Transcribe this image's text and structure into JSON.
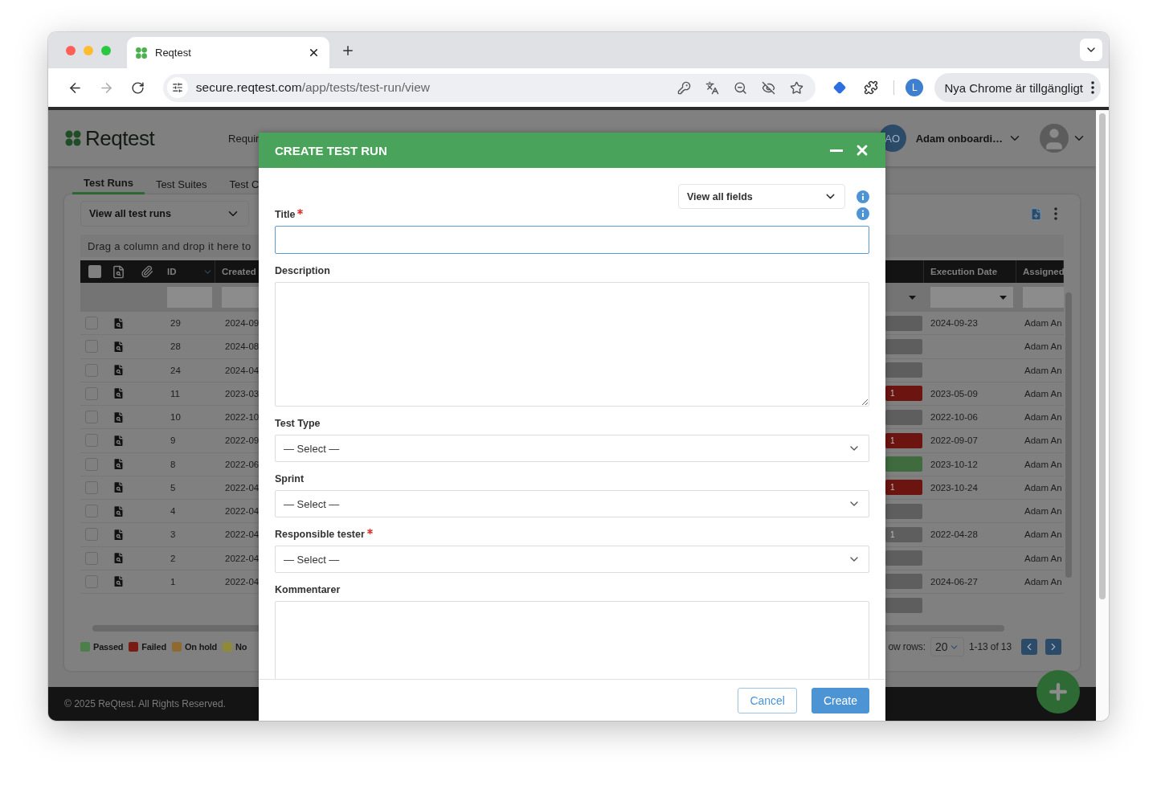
{
  "browser": {
    "tab_title": "Reqtest",
    "url_host": "secure.reqtest.com",
    "url_path": "/app/tests/test-run/view",
    "profile_initial": "L",
    "update_notice": "Nya Chrome är tillgängligt"
  },
  "app": {
    "logo": "Reqtest",
    "nav": [
      "Requir"
    ],
    "user": {
      "initials": "AO",
      "name": "Adam onboardi…"
    },
    "tabs": [
      {
        "label": "Test Runs",
        "selected": true
      },
      {
        "label": "Test Suites",
        "selected": false
      },
      {
        "label": "Test C",
        "selected": false
      }
    ],
    "view_select": "View all test runs",
    "group_hint": "Drag a column and drop it here to",
    "table": {
      "select_all_checked": false,
      "columns": [
        "ID",
        "Created",
        "Execution Date",
        "Assigned"
      ],
      "rows": [
        {
          "checked": false,
          "id": "29",
          "created": "2024-09",
          "color": "#5e5e5e",
          "execution_date": "2024-09-23",
          "assigned": "Adam An"
        },
        {
          "checked": false,
          "id": "28",
          "created": "2024-08",
          "color": "#5e5e5e",
          "assigned": "Adam An"
        },
        {
          "checked": false,
          "id": "24",
          "created": "2024-04",
          "color": "#5e5e5e",
          "assigned": "Adam An"
        },
        {
          "checked": false,
          "id": "11",
          "created": "2023-03",
          "color": "#6b1410",
          "count": "1",
          "execution_date": "2023-05-09",
          "assigned": "Adam An"
        },
        {
          "checked": false,
          "id": "10",
          "created": "2022-10",
          "color": "#5e5e5e",
          "execution_date": "2022-10-06",
          "assigned": "Adam An"
        },
        {
          "checked": false,
          "id": "9",
          "created": "2022-09",
          "color": "#6b1410",
          "count": "1",
          "execution_date": "2022-09-07",
          "assigned": "Adam An"
        },
        {
          "checked": false,
          "id": "8",
          "created": "2022-06",
          "color": "#3f6b3e",
          "execution_date": "2023-10-12",
          "assigned": "Adam An"
        },
        {
          "checked": false,
          "id": "5",
          "created": "2022-04",
          "color": "#6b1410",
          "count": "1",
          "execution_date": "2023-10-24",
          "assigned": "Adam An"
        },
        {
          "checked": false,
          "id": "4",
          "created": "2022-04",
          "color": "#5e5e5e",
          "assigned": "Adam An"
        },
        {
          "checked": false,
          "id": "3",
          "created": "2022-04",
          "color": "#5e5e5e",
          "count": "1",
          "execution_date": "2022-04-28",
          "assigned": "Adam An"
        },
        {
          "checked": false,
          "id": "2",
          "created": "2022-04",
          "color": "#5e5e5e",
          "assigned": "Adam An"
        },
        {
          "checked": false,
          "id": "1",
          "created": "2022-04",
          "color": "#5e5e5e",
          "execution_date": "2024-06-27",
          "assigned": "Adam An"
        },
        {
          "color": "#5e5e5e"
        }
      ]
    },
    "legend": [
      {
        "label": "Passed",
        "color": "#4c7f4a"
      },
      {
        "label": "Failed",
        "color": "#7a1a14"
      },
      {
        "label": "On hold",
        "color": "#8f6a2e"
      },
      {
        "label": "No",
        "color": "#8f8a3a"
      }
    ],
    "pagination": {
      "label": "ow rows:",
      "page_size": "20",
      "range": "1-13 of 13"
    },
    "footer": "© 2025 ReQtest. All Rights Reserved."
  },
  "modal": {
    "title": "CREATE TEST RUN",
    "view_select": "View all fields",
    "fields": [
      {
        "kind": "text",
        "label": "Title",
        "required": true
      },
      {
        "kind": "textarea",
        "label": "Description",
        "required": false
      },
      {
        "kind": "select",
        "label": "Test Type",
        "required": false,
        "value": "— Select —"
      },
      {
        "kind": "select",
        "label": "Sprint",
        "required": false,
        "value": "— Select —"
      },
      {
        "kind": "select",
        "label": "Responsible tester",
        "required": true,
        "value": "— Select —"
      },
      {
        "kind": "textarea",
        "label": "Kommentarer",
        "required": false
      }
    ],
    "buttons": [
      {
        "kind": "secondary",
        "label": "Cancel"
      },
      {
        "kind": "primary",
        "label": "Create"
      }
    ]
  }
}
